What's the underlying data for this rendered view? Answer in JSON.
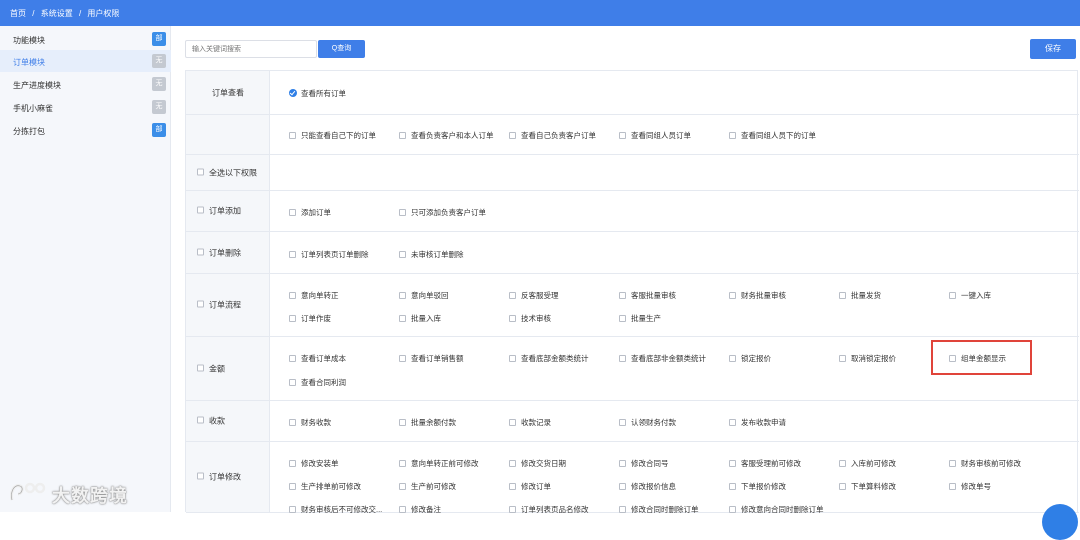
{
  "breadcrumb": [
    "首页",
    "/",
    "系统设置",
    "/",
    "用户权限"
  ],
  "sidebar": {
    "items": [
      {
        "label": "功能模块",
        "badge": "部",
        "badge_color": "#3b8ee8",
        "active": false
      },
      {
        "label": "订单模块",
        "badge": "无",
        "badge_color": "#c4c9d1",
        "active": true
      },
      {
        "label": "生产进度模块",
        "badge": "无",
        "badge_color": "#c4c9d1",
        "active": false
      },
      {
        "label": "手机小麻雀",
        "badge": "无",
        "badge_color": "#c4c9d1",
        "active": false
      },
      {
        "label": "分拣打包",
        "badge": "部",
        "badge_color": "#3b8ee8",
        "active": false
      }
    ]
  },
  "watermark": "大数跨境",
  "search": {
    "placeholder": "输入关键词搜索",
    "button": "Q查询"
  },
  "save_label": "保存",
  "permissions": {
    "order_view": {
      "label": "订单查看",
      "selected": "查看所有订单"
    },
    "view_options": [
      "只能查看自己下的订单",
      "查看负责客户和本人订单",
      "查看自己负责客户订单",
      "查看同组人员订单",
      "查看同组人员下的订单"
    ],
    "select_all": "全选以下权限",
    "order_add": {
      "label": "订单添加",
      "options": [
        "添加订单",
        "只可添加负责客户订单"
      ]
    },
    "order_delete": {
      "label": "订单删除",
      "options": [
        "订单列表页订单删除",
        "未审核订单删除"
      ]
    },
    "order_flow": {
      "label": "订单流程",
      "options": [
        "意向单转正",
        "意向单驳回",
        "反客服受理",
        "客服批量审核",
        "财务批量审核",
        "批量发货",
        "一键入库",
        "订单作废",
        "批量入库",
        "技术审核",
        "批量生产"
      ]
    },
    "amount": {
      "label": "金额",
      "options": [
        "查看订单成本",
        "查看订单销售额",
        "查看底部金额类统计",
        "查看底部非金额类统计",
        "锁定报价",
        "取消锁定报价",
        "组单金额显示",
        "查看合同利润"
      ]
    },
    "payment": {
      "label": "收款",
      "options": [
        "财务收款",
        "批量余额付款",
        "收款记录",
        "认领财务付款",
        "发布收款申请"
      ]
    },
    "order_edit": {
      "label": "订单修改",
      "options": [
        "修改安装单",
        "意向单转正前可修改",
        "修改交货日期",
        "修改合同号",
        "客服受理前可修改",
        "入库前可修改",
        "财务审核前可修改",
        "生产排单前可修改",
        "生产前可修改",
        "修改订单",
        "修改报价信息",
        "下单报价修改",
        "下单算料修改",
        "修改单号",
        "财务审核后不可修改交...",
        "修改备注",
        "订单列表页品名修改",
        "修改合同时删除订单",
        "修改意向合同时删除订单"
      ]
    }
  }
}
